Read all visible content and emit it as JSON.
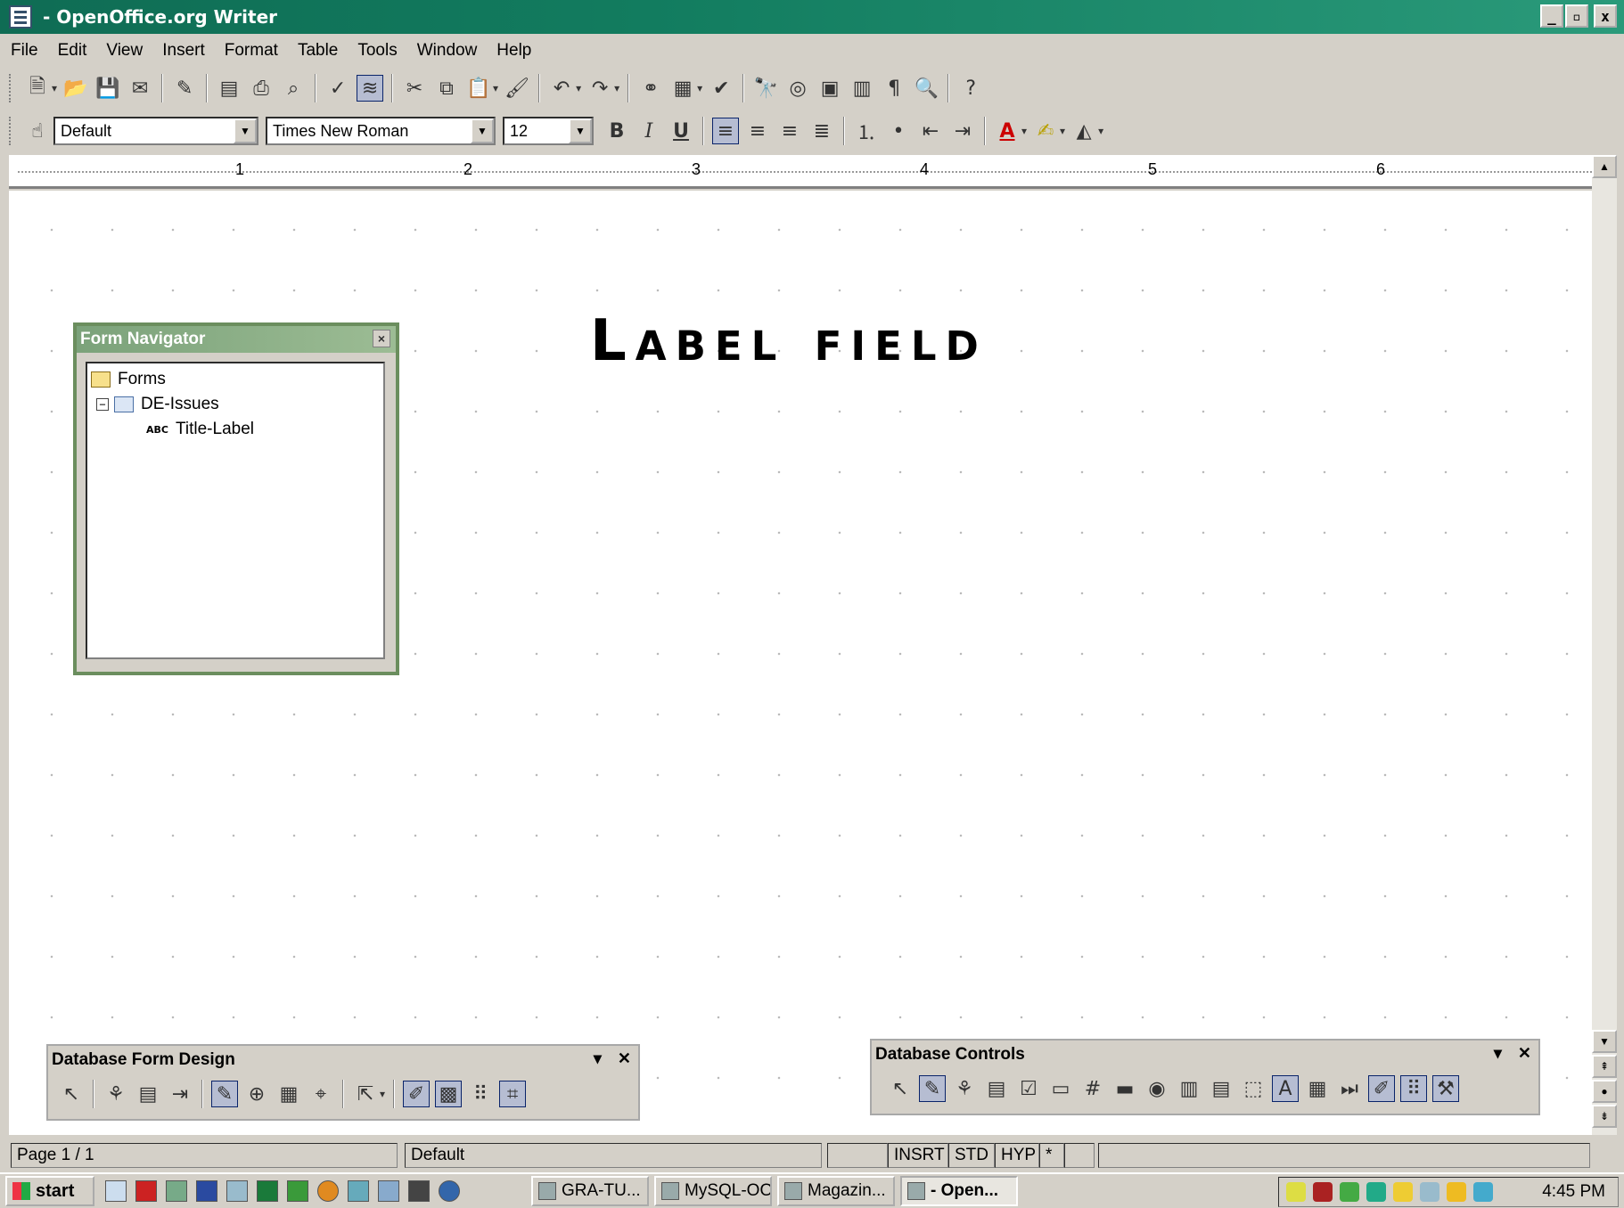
{
  "window": {
    "title": "- OpenOffice.org Writer",
    "controls": [
      "_",
      "▫",
      "x"
    ]
  },
  "menu": [
    "File",
    "Edit",
    "View",
    "Insert",
    "Format",
    "Table",
    "Tools",
    "Window",
    "Help"
  ],
  "format_bar": {
    "style": "Default",
    "font": "Times New Roman",
    "size": "12",
    "bold": "B",
    "italic": "I",
    "underline": "U"
  },
  "ruler": [
    "1",
    "2",
    "3",
    "4",
    "5",
    "6"
  ],
  "document": {
    "label_text": "Label field"
  },
  "form_navigator": {
    "title": "Form Navigator",
    "close": "×",
    "tree": [
      {
        "label": "Forms",
        "level": 0
      },
      {
        "label": "DE-Issues",
        "level": 1,
        "expander": "−"
      },
      {
        "label": "Title-Label",
        "level": 2,
        "prefix": "ABC"
      }
    ]
  },
  "db_form_design": {
    "title": "Database Form Design",
    "menu": "▾",
    "close": "✕"
  },
  "db_controls": {
    "title": "Database Controls",
    "menu": "▾",
    "close": "✕"
  },
  "statusbar": {
    "page": "Page 1 / 1",
    "style": "Default",
    "insert": "INSRT",
    "std": "STD",
    "hyp": "HYP",
    "modified": "*"
  },
  "taskbar": {
    "start": "start",
    "tasks": [
      "GRA-TU...",
      "MySQL-OO",
      "Magazin...",
      "- Open..."
    ],
    "clock": "4:45 PM"
  }
}
